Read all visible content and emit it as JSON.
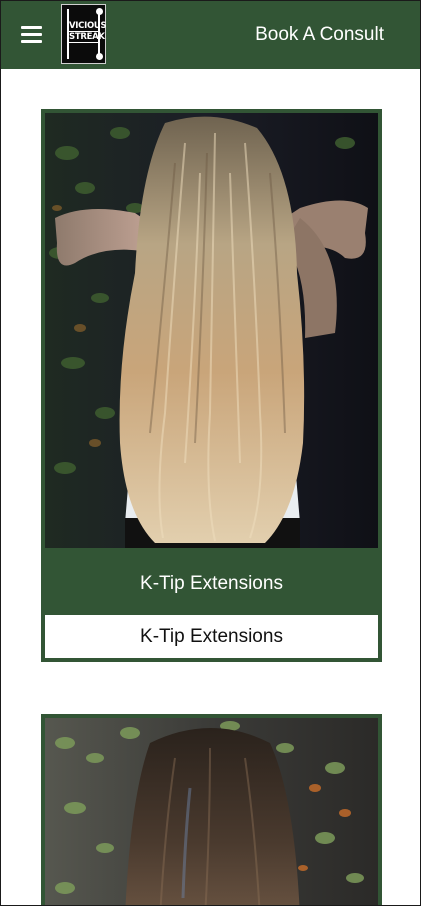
{
  "header": {
    "menu_icon": "hamburger-menu-icon",
    "logo_line1": "VICIOUS",
    "logo_line2": "STREAK",
    "book_label": "Book A Consult"
  },
  "colors": {
    "brand_green": "#325535",
    "white": "#ffffff"
  },
  "services": [
    {
      "title": "K-Tip Extensions",
      "button_label": "K-Tip Extensions"
    }
  ]
}
